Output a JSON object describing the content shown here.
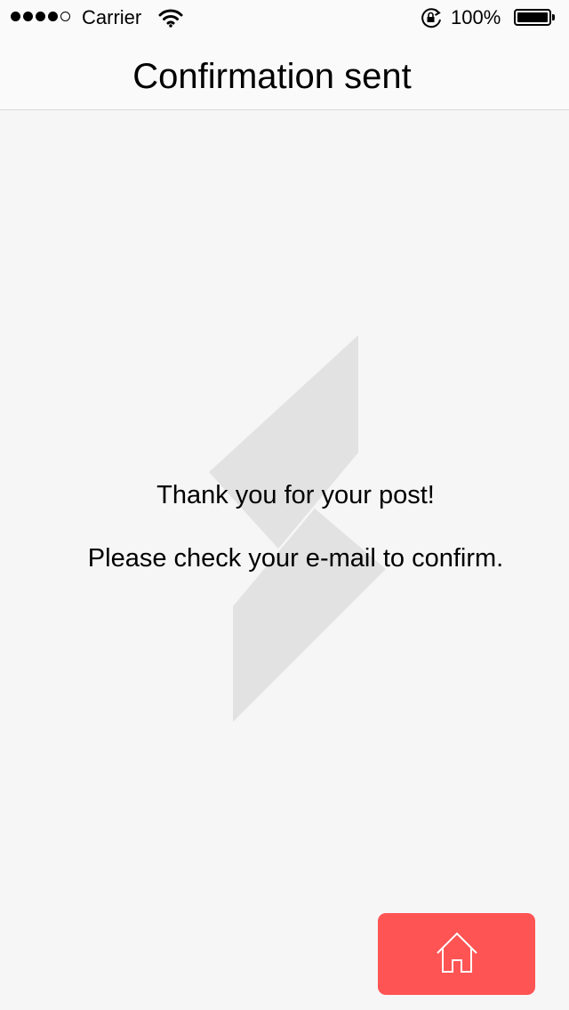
{
  "status_bar": {
    "signal_bars_filled": 4,
    "signal_bars_total": 5,
    "carrier": "Carrier",
    "wifi_icon": "wifi-icon",
    "rotation_lock_icon": "rotation-lock-icon",
    "battery_percent_label": "100%",
    "battery_level": 1.0
  },
  "nav": {
    "title": "Confirmation sent"
  },
  "main": {
    "watermark_icon": "logo-watermark",
    "message_line1": "Thank you for your post!",
    "message_line2": "Please check your e-mail to confirm."
  },
  "home_button": {
    "icon": "home-icon"
  },
  "colors": {
    "accent": "#fe5454",
    "background": "#f6f6f6",
    "bar_background": "#fafafa",
    "watermark": "#e2e2e2"
  }
}
